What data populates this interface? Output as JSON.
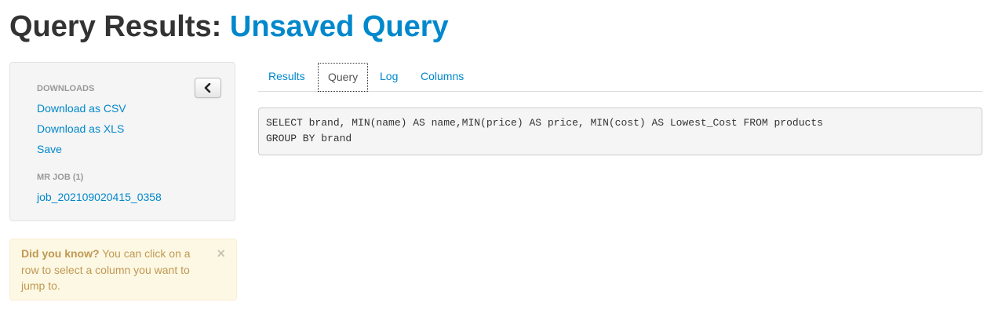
{
  "header": {
    "title_prefix": "Query Results:",
    "query_name": "Unsaved Query"
  },
  "sidebar": {
    "downloads_header": "DOWNLOADS",
    "links": [
      {
        "label": "Download as CSV"
      },
      {
        "label": "Download as XLS"
      },
      {
        "label": "Save"
      }
    ],
    "mr_job_header": "MR JOB (1)",
    "job_link": "job_202109020415_0358",
    "collapse_icon": "chevron-left-icon"
  },
  "tip": {
    "title": "Did you know?",
    "text": "You can click on a row to select a column you want to jump to.",
    "close_glyph": "×"
  },
  "tabs": [
    {
      "label": "Results",
      "active": false
    },
    {
      "label": "Query",
      "active": true
    },
    {
      "label": "Log",
      "active": false
    },
    {
      "label": "Columns",
      "active": false
    }
  ],
  "query": {
    "line1": "SELECT brand, MIN(name) AS name,MIN(price) AS price, MIN(cost) AS Lowest_Cost FROM products",
    "line2": "GROUP BY brand"
  },
  "colors": {
    "link": "#0088cc",
    "title": "#333333",
    "alert_text": "#c09853",
    "alert_bg": "#fcf8e3"
  }
}
